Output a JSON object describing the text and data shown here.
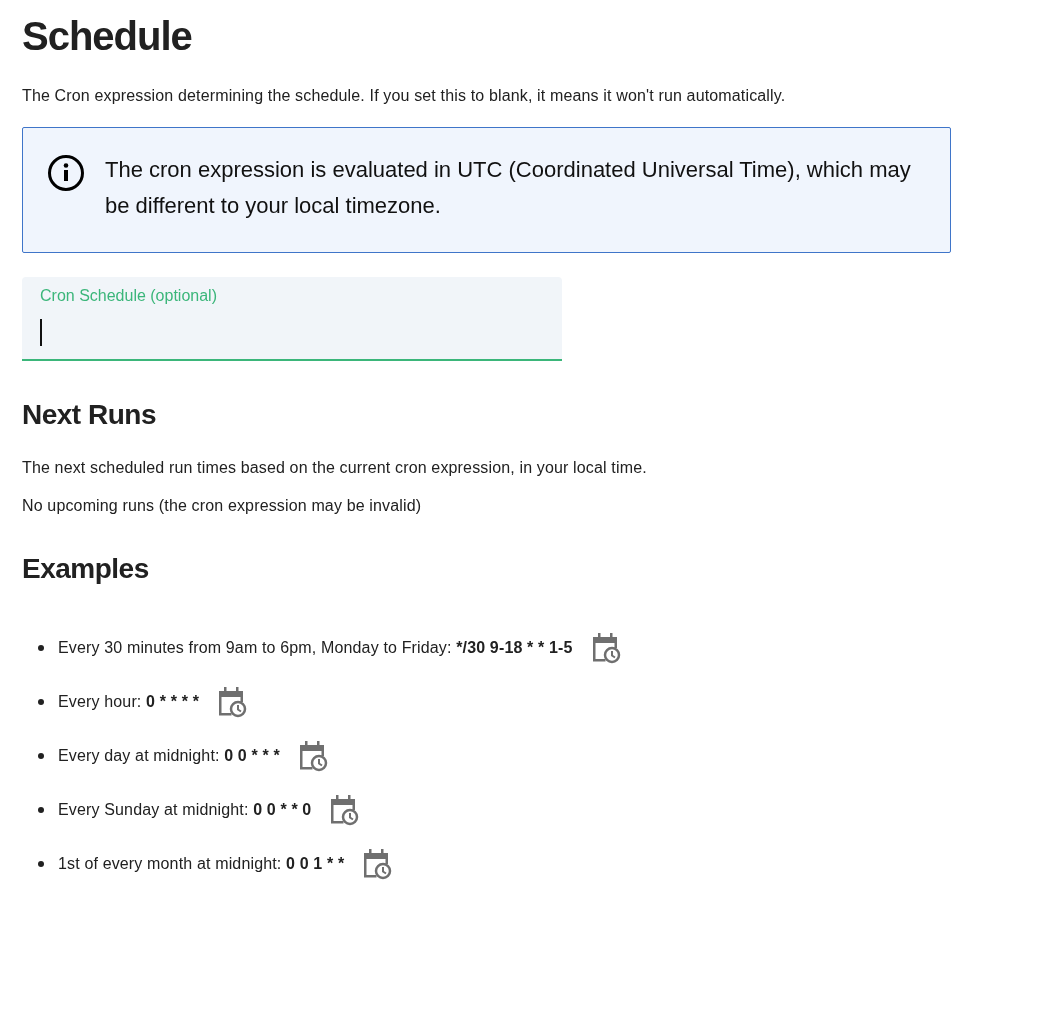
{
  "title": "Schedule",
  "description": "The Cron expression determining the schedule. If you set this to blank, it means it won't run automatically.",
  "info_alert": {
    "text": "The cron expression is evaluated in UTC (Coordinated Universal Time), which may be different to your local timezone."
  },
  "cron_field": {
    "label": "Cron Schedule (optional)",
    "focused": true
  },
  "next_runs": {
    "heading": "Next Runs",
    "description": "The next scheduled run times based on the current cron expression, in your local time.",
    "empty_message": "No upcoming runs (the cron expression may be invalid)"
  },
  "examples": {
    "heading": "Examples",
    "items": [
      {
        "description": "Every 30 minutes from 9am to 6pm, Monday to Friday:",
        "expression": "*/30 9-18 * * 1-5"
      },
      {
        "description": "Every hour:",
        "expression": "0 * * * *"
      },
      {
        "description": "Every day at midnight:",
        "expression": "0 0 * * *"
      },
      {
        "description": "Every Sunday at midnight:",
        "expression": "0 0 * * 0"
      },
      {
        "description": "1st of every month at midnight:",
        "expression": "0 0 1 * *"
      }
    ]
  }
}
